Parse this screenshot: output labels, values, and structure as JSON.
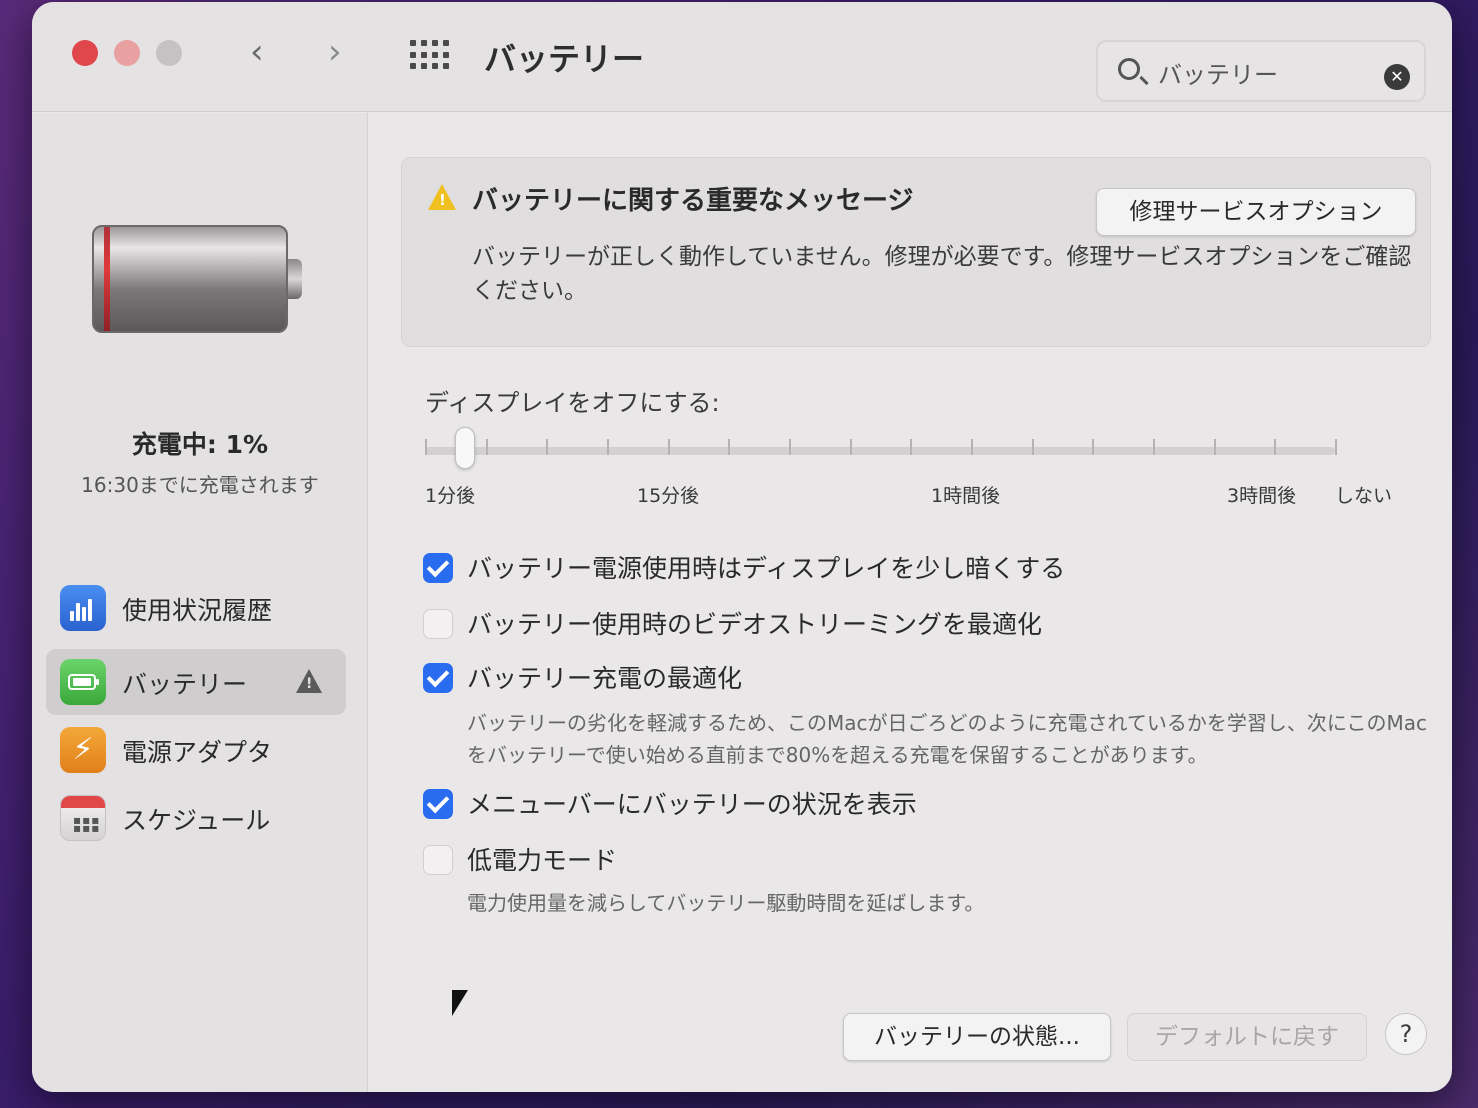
{
  "window": {
    "title": "バッテリー",
    "nav_back": "‹",
    "nav_forward": "›"
  },
  "search": {
    "value": "バッテリー",
    "clear": "✕"
  },
  "sidebar": {
    "charge_status": "充電中: 1%",
    "charge_until": "16:30までに充電されます",
    "battery_level_percent": 1,
    "items": [
      {
        "label": "使用状況履歴",
        "icon": "usage-chart-icon"
      },
      {
        "label": "バッテリー",
        "icon": "battery-icon",
        "selected": true,
        "warning": true
      },
      {
        "label": "電源アダプタ",
        "icon": "power-adapter-icon"
      },
      {
        "label": "スケジュール",
        "icon": "calendar-icon"
      }
    ]
  },
  "alert": {
    "title": "バッテリーに関する重要なメッセージ",
    "button": "修理サービスオプション",
    "body": "バッテリーが正しく動作していません。修理が必要です。修理サービスオプションをご確認ください。",
    "icon": "warning-icon",
    "icon_color": "#f0c020"
  },
  "display_off": {
    "label": "ディスプレイをオフにする:",
    "tick_labels": [
      "1分後",
      "15分後",
      "1時間後",
      "3時間後",
      "しない"
    ],
    "selected": "1分後"
  },
  "options": [
    {
      "label": "バッテリー電源使用時はディスプレイを少し暗くする",
      "checked": true
    },
    {
      "label": "バッテリー使用時のビデオストリーミングを最適化",
      "checked": false
    },
    {
      "label": "バッテリー充電の最適化",
      "checked": true,
      "description": "バッテリーの劣化を軽減するため、このMacが日ごろどのように充電されているかを学習し、次にこのMacをバッテリーで使い始める直前まで80%を超える充電を保留することがあります。"
    },
    {
      "label": "メニューバーにバッテリーの状況を表示",
      "checked": true
    },
    {
      "label": "低電力モード",
      "checked": false,
      "description": "電力使用量を減らしてバッテリー駆動時間を延ばします。"
    }
  ],
  "buttons": {
    "battery_health": "バッテリーの状態...",
    "restore_defaults": "デフォルトに戻す",
    "help": "?"
  },
  "colors": {
    "accent": "#2a6cf0",
    "close": "#e0474c",
    "battery_low": "#e03a3a"
  }
}
